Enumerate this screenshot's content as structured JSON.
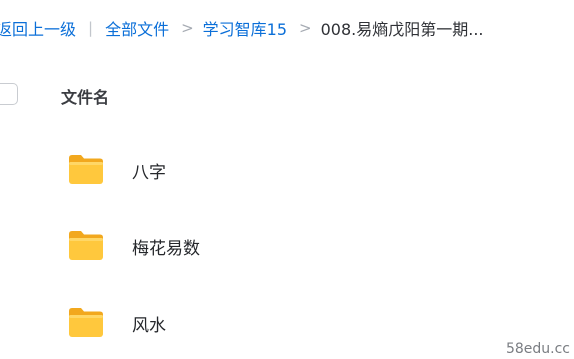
{
  "breadcrumb": {
    "back_label": "返回上一级",
    "divider": "|",
    "items": [
      {
        "label": "全部文件"
      },
      {
        "label": "学习智库15"
      }
    ],
    "separator": ">",
    "current": "008.易熵戊阳第一期..."
  },
  "list_header": {
    "name_column": "文件名"
  },
  "files": [
    {
      "name": "八字",
      "icon": "folder-icon"
    },
    {
      "name": "梅花易数",
      "icon": "folder-icon"
    },
    {
      "name": "风水",
      "icon": "folder-icon"
    }
  ],
  "watermark": "58edu.cc",
  "colors": {
    "link": "#0b6fd8",
    "folder_body": "#FFC83D",
    "folder_back": "#F2A81E"
  }
}
